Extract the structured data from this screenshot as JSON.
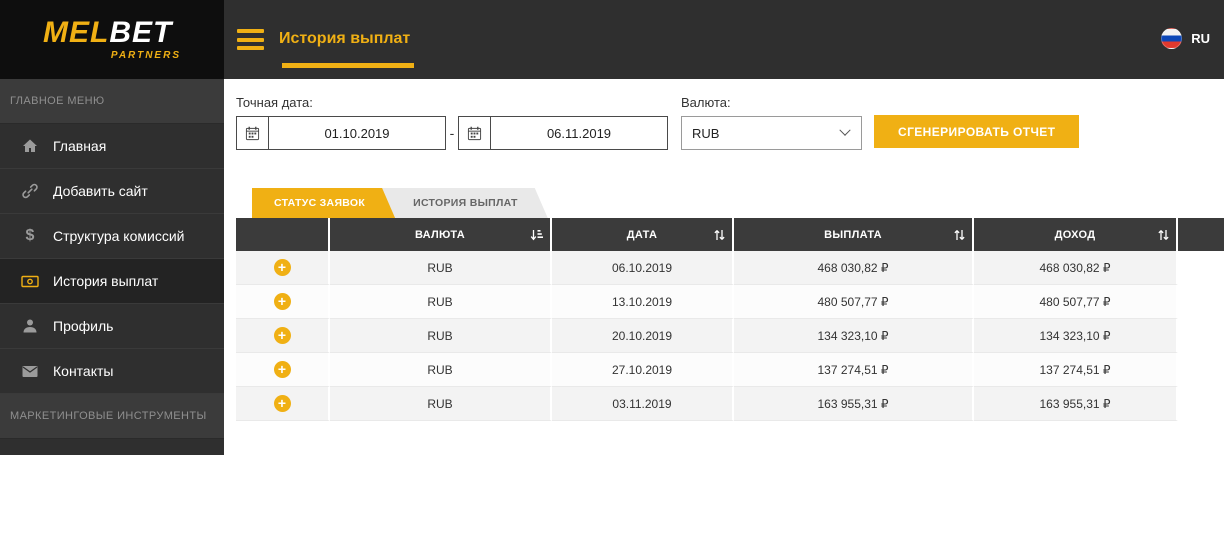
{
  "brand": {
    "logo_mel": "MEL",
    "logo_bet": "BET",
    "logo_sub": "PARTNERS"
  },
  "header": {
    "title": "История выплат",
    "lang": "RU"
  },
  "sidebar": {
    "section_main": "ГЛАВНОЕ МЕНЮ",
    "section_marketing": "МАРКЕТИНГОВЫЕ ИНСТРУМЕНТЫ",
    "items": [
      {
        "label": "Главная",
        "icon": "home-icon",
        "active": false
      },
      {
        "label": "Добавить сайт",
        "icon": "link-icon",
        "active": false
      },
      {
        "label": "Структура комиссий",
        "icon": "dollar-icon",
        "active": false
      },
      {
        "label": "История выплат",
        "icon": "banknote-icon",
        "active": true
      },
      {
        "label": "Профиль",
        "icon": "user-icon",
        "active": false
      },
      {
        "label": "Контакты",
        "icon": "envelope-icon",
        "active": false
      }
    ]
  },
  "filters": {
    "date_label": "Точная дата:",
    "date_from": "01.10.2019",
    "date_to": "06.11.2019",
    "date_separator": "-",
    "currency_label": "Валюта:",
    "currency_value": "RUB",
    "generate_button": "СГЕНЕРИРОВАТЬ ОТЧЕТ"
  },
  "tabs": [
    {
      "label": "СТАТУС ЗАЯВОК",
      "active": true
    },
    {
      "label": "ИСТОРИЯ ВЫПЛАТ",
      "active": false
    }
  ],
  "table": {
    "columns": [
      "",
      "ВАЛЮТА",
      "ДАТА",
      "ВЫПЛАТА",
      "ДОХОД"
    ],
    "rows": [
      {
        "currency": "RUB",
        "date": "06.10.2019",
        "payout": "468 030,82 ₽",
        "income": "468 030,82 ₽"
      },
      {
        "currency": "RUB",
        "date": "13.10.2019",
        "payout": "480 507,77 ₽",
        "income": "480 507,77 ₽"
      },
      {
        "currency": "RUB",
        "date": "20.10.2019",
        "payout": "134 323,10 ₽",
        "income": "134 323,10 ₽"
      },
      {
        "currency": "RUB",
        "date": "27.10.2019",
        "payout": "137 274,51 ₽",
        "income": "137 274,51 ₽"
      },
      {
        "currency": "RUB",
        "date": "03.11.2019",
        "payout": "163 955,31 ₽",
        "income": "163 955,31 ₽"
      }
    ]
  },
  "icons": {
    "menu": "hamburger-icon",
    "calendar": "calendar-icon",
    "chevron": "chevron-down-icon",
    "flag": "ru-flag-icon",
    "expand": "plus-circle-icon",
    "sort_currency": "sort-amount-icon",
    "sort_generic": "sort-arrows-icon"
  },
  "colors": {
    "accent": "#F0B014",
    "topbar_bg": "#2F2F2F",
    "logo_bg": "#0E0E0E",
    "table_header_bg": "#3B3B3B",
    "row_stripe": "#F3F3F3"
  }
}
